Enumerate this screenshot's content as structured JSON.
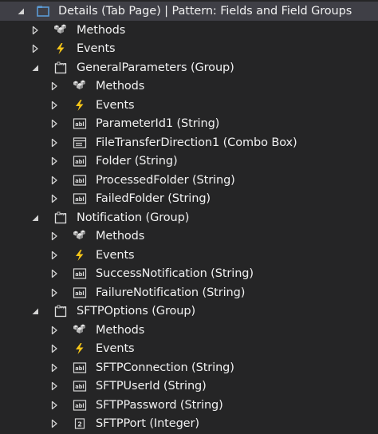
{
  "tree": {
    "rows": [
      {
        "level": 0,
        "expanded": true,
        "icon": "tab-page-icon",
        "label": "Details (Tab Page) | Pattern: Fields and Field Groups",
        "selected": true
      },
      {
        "level": 1,
        "expanded": false,
        "icon": "methods-icon",
        "label": "Methods"
      },
      {
        "level": 1,
        "expanded": false,
        "icon": "events-icon",
        "label": "Events"
      },
      {
        "level": 1,
        "expanded": true,
        "icon": "group-icon",
        "label": "GeneralParameters (Group)"
      },
      {
        "level": 2,
        "expanded": false,
        "icon": "methods-icon",
        "label": "Methods"
      },
      {
        "level": 2,
        "expanded": false,
        "icon": "events-icon",
        "label": "Events"
      },
      {
        "level": 2,
        "expanded": false,
        "icon": "string-field-icon",
        "label": "ParameterId1 (String)"
      },
      {
        "level": 2,
        "expanded": false,
        "icon": "combo-box-icon",
        "label": "FileTransferDirection1 (Combo Box)"
      },
      {
        "level": 2,
        "expanded": false,
        "icon": "string-field-icon",
        "label": "Folder (String)"
      },
      {
        "level": 2,
        "expanded": false,
        "icon": "string-field-icon",
        "label": "ProcessedFolder (String)"
      },
      {
        "level": 2,
        "expanded": false,
        "icon": "string-field-icon",
        "label": "FailedFolder (String)"
      },
      {
        "level": 1,
        "expanded": true,
        "icon": "group-icon",
        "label": "Notification (Group)"
      },
      {
        "level": 2,
        "expanded": false,
        "icon": "methods-icon",
        "label": "Methods"
      },
      {
        "level": 2,
        "expanded": false,
        "icon": "events-icon",
        "label": "Events"
      },
      {
        "level": 2,
        "expanded": false,
        "icon": "string-field-icon",
        "label": "SuccessNotification (String)"
      },
      {
        "level": 2,
        "expanded": false,
        "icon": "string-field-icon",
        "label": "FailureNotification (String)"
      },
      {
        "level": 1,
        "expanded": true,
        "icon": "group-icon",
        "label": "SFTPOptions (Group)"
      },
      {
        "level": 2,
        "expanded": false,
        "icon": "methods-icon",
        "label": "Methods"
      },
      {
        "level": 2,
        "expanded": false,
        "icon": "events-icon",
        "label": "Events"
      },
      {
        "level": 2,
        "expanded": false,
        "icon": "string-field-icon",
        "label": "SFTPConnection (String)"
      },
      {
        "level": 2,
        "expanded": false,
        "icon": "string-field-icon",
        "label": "SFTPUserId (String)"
      },
      {
        "level": 2,
        "expanded": false,
        "icon": "string-field-icon",
        "label": "SFTPPassword (String)"
      },
      {
        "level": 2,
        "expanded": false,
        "icon": "integer-field-icon",
        "label": "SFTPPort (Integer)"
      }
    ]
  },
  "colors": {
    "background": "#252526",
    "selected_row": "#3f3f46",
    "text": "#f1f1f1",
    "arrow": "#d4d4d4",
    "tab_page_icon": "#5b9bd5",
    "event_bolt": "#f5c518"
  }
}
